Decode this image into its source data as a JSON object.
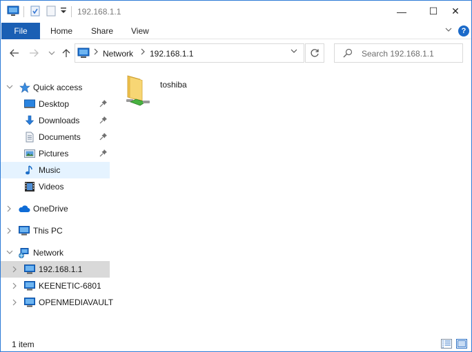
{
  "window": {
    "title": "192.168.1.1",
    "controls": {
      "minimize": "—",
      "maximize": "☐",
      "close": "✕"
    }
  },
  "ribbon": {
    "tabs": [
      "File",
      "Home",
      "Share",
      "View"
    ],
    "help": "?"
  },
  "nav": {
    "address": {
      "segments": [
        "Network",
        "192.168.1.1"
      ]
    },
    "search": {
      "placeholder": "Search 192.168.1.1"
    }
  },
  "sidebar": {
    "quick_access": "Quick access",
    "quick_items": [
      {
        "label": "Desktop",
        "icon": "desktop-icon",
        "pinned": true
      },
      {
        "label": "Downloads",
        "icon": "downloads-icon",
        "pinned": true
      },
      {
        "label": "Documents",
        "icon": "documents-icon",
        "pinned": true
      },
      {
        "label": "Pictures",
        "icon": "pictures-icon",
        "pinned": true
      },
      {
        "label": "Music",
        "icon": "music-icon",
        "pinned": false
      },
      {
        "label": "Videos",
        "icon": "videos-icon",
        "pinned": false
      }
    ],
    "onedrive": "OneDrive",
    "this_pc": "This PC",
    "network": "Network",
    "network_items": [
      "192.168.1.1",
      "KEENETIC-6801",
      "OPENMEDIAVAULT"
    ]
  },
  "content": {
    "items": [
      {
        "name": "toshiba",
        "icon": "network-share-folder-icon"
      }
    ]
  },
  "status": {
    "item_count": "1 item"
  },
  "colors": {
    "accent": "#1a5fb4",
    "selection": "#d9d9d9",
    "hover": "#e5f3ff"
  }
}
